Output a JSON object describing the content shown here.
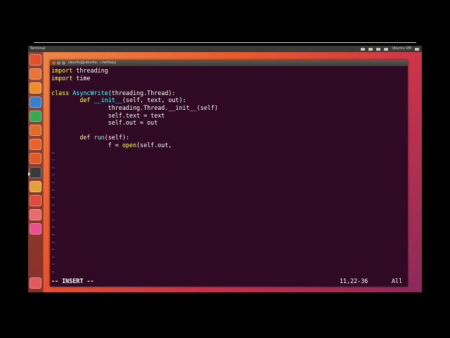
{
  "panel": {
    "title": "Terminal",
    "user": "Ubuntu VM"
  },
  "window": {
    "title": "ubuntu@ubuntu: ~/writepy"
  },
  "launcher": {
    "items": [
      {
        "name": "dash-home-icon",
        "color": "#e0502a"
      },
      {
        "name": "files-icon",
        "color": "#e8743a"
      },
      {
        "name": "firefox-icon",
        "color": "#f08c2a"
      },
      {
        "name": "writer-icon",
        "color": "#3a7fc8"
      },
      {
        "name": "calc-icon",
        "color": "#3aa850"
      },
      {
        "name": "impress-icon",
        "color": "#e06a2a"
      },
      {
        "name": "software-center-icon",
        "color": "#e8622a"
      },
      {
        "name": "ubuntu-one-icon",
        "color": "#e05a28"
      },
      {
        "name": "terminal-icon",
        "color": "#3a3a3a"
      },
      {
        "name": "system-settings-icon",
        "color": "#e6a03a"
      },
      {
        "name": "help-icon",
        "color": "#e04a3a"
      },
      {
        "name": "workspace-switcher-icon",
        "color": "#e86a6a"
      },
      {
        "name": "dvd-icon",
        "color": "#e8508a"
      },
      {
        "name": "trash-icon",
        "color": "#e05a5a"
      }
    ]
  },
  "editor": {
    "lines": [
      [
        {
          "t": "import",
          "c": "kw"
        },
        {
          "t": " threading"
        }
      ],
      [
        {
          "t": "import",
          "c": "kw"
        },
        {
          "t": " time"
        }
      ],
      [],
      [
        {
          "t": "class",
          "c": "kw"
        },
        {
          "t": " "
        },
        {
          "t": "AsyncWrite",
          "c": "fn"
        },
        {
          "t": "(threading.Thread):"
        }
      ],
      [
        {
          "t": "        "
        },
        {
          "t": "def",
          "c": "kw"
        },
        {
          "t": " "
        },
        {
          "t": "__init__",
          "c": "fn"
        },
        {
          "t": "(self, text, out):"
        }
      ],
      [
        {
          "t": "                threading.Thread.__init__(self)"
        }
      ],
      [
        {
          "t": "                self.text = text"
        }
      ],
      [
        {
          "t": "                self.out = out"
        }
      ],
      [],
      [
        {
          "t": "        "
        },
        {
          "t": "def",
          "c": "kw"
        },
        {
          "t": " "
        },
        {
          "t": "run",
          "c": "fn"
        },
        {
          "t": "(self):"
        }
      ],
      [
        {
          "t": "                f = "
        },
        {
          "t": "open",
          "c": "kw"
        },
        {
          "t": "(self.out,"
        }
      ]
    ],
    "tilde_count": 17,
    "tilde_char": "~"
  },
  "status": {
    "mode": "-- INSERT --",
    "position": "11,22-36",
    "percent": "All"
  }
}
